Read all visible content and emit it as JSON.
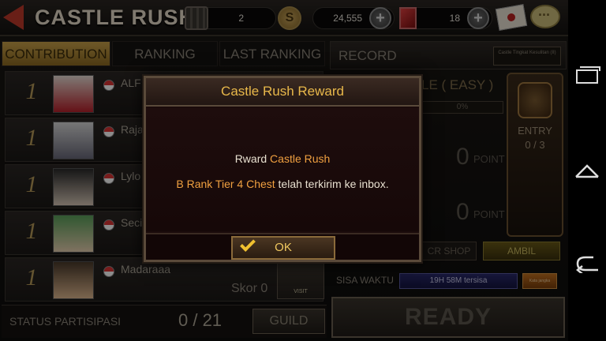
{
  "header": {
    "title": "CASTLE RUSH",
    "towers": "2",
    "gold": "24,555",
    "gems": "18"
  },
  "tabs": [
    {
      "label": "CONTRIBUTION",
      "active": true
    },
    {
      "label": "RANKING",
      "active": false
    },
    {
      "label": "LAST RANKING",
      "active": false
    }
  ],
  "players": [
    {
      "rank": "1",
      "name": "ALF"
    },
    {
      "rank": "1",
      "name": "Raja"
    },
    {
      "rank": "1",
      "name": "Lylo"
    },
    {
      "rank": "1",
      "name": "Seci"
    },
    {
      "rank": "1",
      "name": "Madaraaa",
      "score": "Skor 0",
      "visit": "VISIT"
    }
  ],
  "status": {
    "label": "STATUS PARTISIPASI",
    "count": "0 / 21",
    "guild_label": "GUILD"
  },
  "record": {
    "label": "RECORD",
    "badge": "Castle Tingkat Kesulitan (II)",
    "mode_title": "LE ( EASY )",
    "progress": "0%",
    "points": [
      {
        "value": "0",
        "label": "POINT"
      },
      {
        "value": "0",
        "label": "POINT"
      }
    ],
    "entry_label": "ENTRY",
    "entry_count": "0 / 3",
    "shop_label": "CR SHOP",
    "ambil_label": "AMBIL",
    "sisa_label": "SISA WAKTU",
    "timer": "19H 58M tersisa",
    "small_btn": "Kata jangka",
    "ready_label": "READY"
  },
  "dialog": {
    "title": "Castle Rush Reward",
    "line1_a": "Rward ",
    "line1_b": "Castle Rush",
    "line2_a": "B Rank Tier 4 Chest",
    "line2_b": " telah terkirim ke inbox.",
    "ok_label": "OK"
  },
  "colors": {
    "accent": "#e8b84a",
    "highlight": "#f0a040"
  }
}
